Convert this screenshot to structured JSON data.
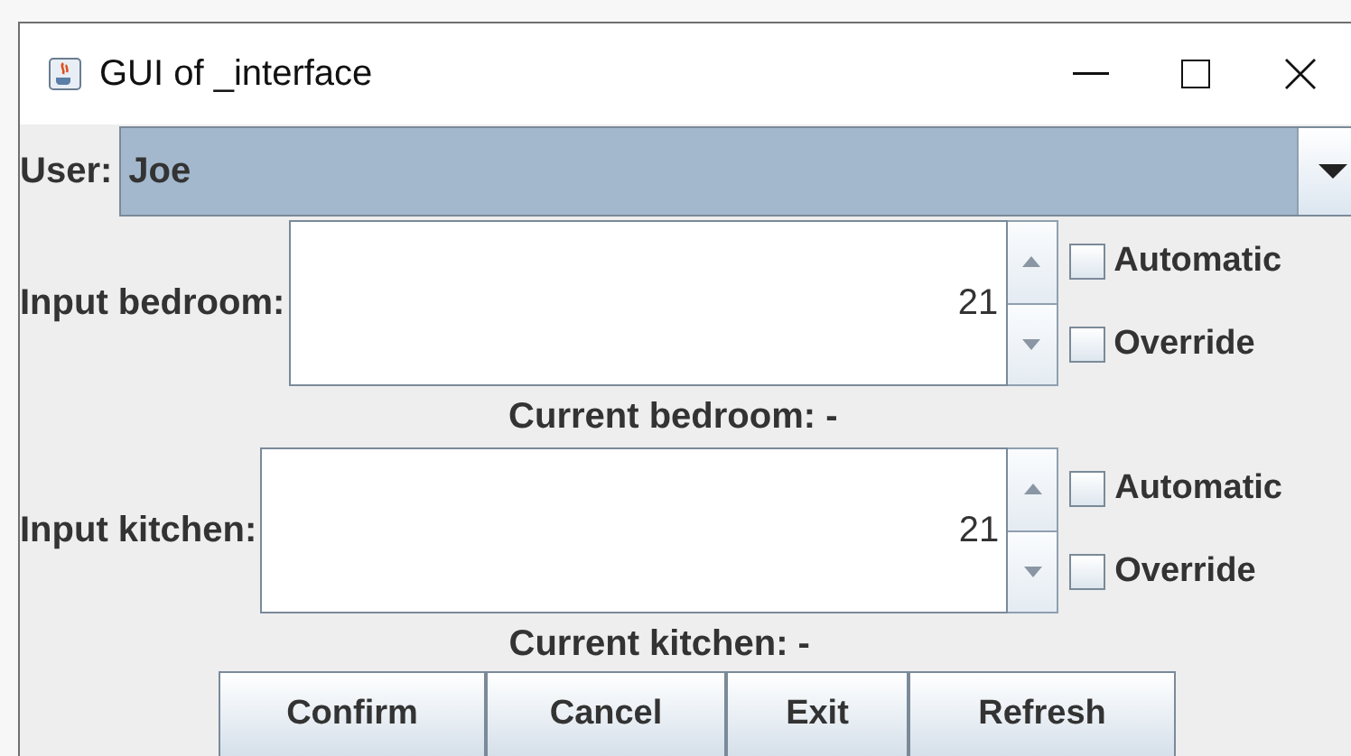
{
  "window": {
    "title": "GUI of _interface"
  },
  "user": {
    "label": "User:",
    "value": "Joe"
  },
  "rooms": [
    {
      "label": "Input bedroom:",
      "value": "21",
      "current": "Current bedroom: -",
      "options": [
        {
          "label": "Automatic",
          "checked": false
        },
        {
          "label": "Override",
          "checked": false
        }
      ]
    },
    {
      "label": "Input kitchen:",
      "value": "21",
      "current": "Current kitchen: -",
      "options": [
        {
          "label": "Automatic",
          "checked": false
        },
        {
          "label": "Override",
          "checked": false
        }
      ]
    }
  ],
  "buttons": [
    "Confirm",
    "Cancel",
    "Exit",
    "Refresh"
  ]
}
